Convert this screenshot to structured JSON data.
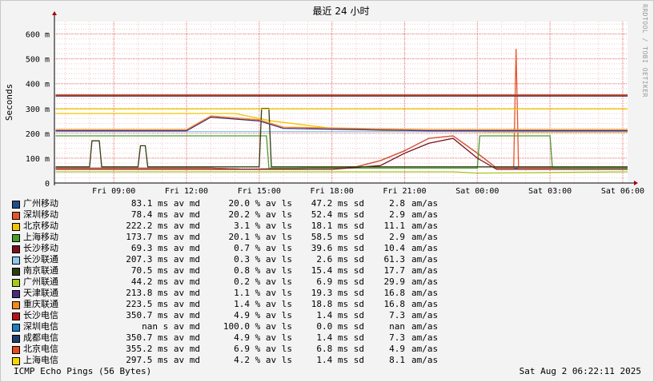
{
  "chart_data": {
    "type": "line",
    "title": "最近 24 小时",
    "ylabel": "Seconds",
    "ylim": [
      0,
      0.65
    ],
    "yticks": [
      {
        "v": 0,
        "label": "0"
      },
      {
        "v": 0.1,
        "label": "100 m"
      },
      {
        "v": 0.2,
        "label": "200 m"
      },
      {
        "v": 0.3,
        "label": "300 m"
      },
      {
        "v": 0.4,
        "label": "400 m"
      },
      {
        "v": 0.5,
        "label": "500 m"
      },
      {
        "v": 0.6,
        "label": "600 m"
      }
    ],
    "xlim": [
      6.55,
      30.2
    ],
    "xticks": [
      {
        "v": 9,
        "label": "Fri 09:00"
      },
      {
        "v": 12,
        "label": "Fri 12:00"
      },
      {
        "v": 15,
        "label": "Fri 15:00"
      },
      {
        "v": 18,
        "label": "Fri 18:00"
      },
      {
        "v": 21,
        "label": "Fri 21:00"
      },
      {
        "v": 24,
        "label": "Sat 00:00"
      },
      {
        "v": 27,
        "label": "Sat 03:00"
      },
      {
        "v": 30,
        "label": "Sat 06:00"
      }
    ],
    "grid": true,
    "legend_position": "bottom",
    "series": [
      {
        "name": "广州移动",
        "color": "#1f4e8c",
        "x": [
          6.6,
          13.0,
          14.5,
          17.0,
          19.0,
          20.0,
          21.0,
          22.0,
          23.0,
          24.0,
          24.8,
          30.2
        ],
        "y": [
          0.06,
          0.06,
          0.055,
          0.06,
          0.065,
          0.09,
          0.13,
          0.18,
          0.19,
          0.12,
          0.06,
          0.06
        ]
      },
      {
        "name": "深圳移动",
        "color": "#e8542a",
        "x": [
          6.6,
          13.0,
          14.5,
          17.0,
          19.0,
          20.0,
          21.0,
          22.0,
          23.0,
          24.0,
          24.8,
          25.5,
          25.6,
          25.7,
          30.2
        ],
        "y": [
          0.06,
          0.06,
          0.055,
          0.06,
          0.065,
          0.09,
          0.13,
          0.18,
          0.19,
          0.12,
          0.06,
          0.06,
          0.54,
          0.06,
          0.06
        ]
      },
      {
        "name": "北京移动",
        "color": "#f2c200",
        "x": [
          6.6,
          14.0,
          15.5,
          18.0,
          20.5,
          22.0,
          24.5,
          27.0,
          30.2
        ],
        "y": [
          0.28,
          0.28,
          0.25,
          0.22,
          0.21,
          0.21,
          0.205,
          0.205,
          0.205
        ]
      },
      {
        "name": "上海移动",
        "color": "#4a9c2e",
        "x": [
          6.6,
          15.3,
          15.4,
          24.0,
          24.1,
          27.0,
          27.1,
          30.2
        ],
        "y": [
          0.19,
          0.19,
          0.06,
          0.06,
          0.19,
          0.19,
          0.06,
          0.06
        ]
      },
      {
        "name": "长沙移动",
        "color": "#7a1020",
        "x": [
          6.6,
          18.0,
          20.0,
          21.0,
          22.0,
          23.0,
          24.0,
          24.8,
          30.2
        ],
        "y": [
          0.055,
          0.055,
          0.07,
          0.12,
          0.16,
          0.18,
          0.1,
          0.055,
          0.055
        ]
      },
      {
        "name": "长沙联通",
        "color": "#8ec9f0",
        "x": [
          6.6,
          30.2
        ],
        "y": [
          0.207,
          0.207
        ]
      },
      {
        "name": "南京联通",
        "color": "#2c3e12",
        "x": [
          6.6,
          8.0,
          8.1,
          8.4,
          8.5,
          10.0,
          10.1,
          10.3,
          10.4,
          15.0,
          15.1,
          15.4,
          15.5,
          30.2
        ],
        "y": [
          0.065,
          0.065,
          0.17,
          0.17,
          0.065,
          0.065,
          0.15,
          0.15,
          0.065,
          0.065,
          0.3,
          0.3,
          0.065,
          0.065
        ]
      },
      {
        "name": "广州联通",
        "color": "#a8c81a",
        "x": [
          6.6,
          23.0,
          24.0,
          30.2
        ],
        "y": [
          0.045,
          0.045,
          0.04,
          0.045
        ]
      },
      {
        "name": "天津联通",
        "color": "#4a2a7a",
        "x": [
          6.6,
          12.0,
          13.0,
          15.0,
          16.0,
          19.0,
          22.0,
          24.0,
          30.2
        ],
        "y": [
          0.21,
          0.21,
          0.265,
          0.25,
          0.22,
          0.215,
          0.21,
          0.21,
          0.21
        ]
      },
      {
        "name": "重庆联通",
        "color": "#f08a1c",
        "x": [
          6.6,
          12.0,
          13.0,
          15.0,
          16.0,
          19.0,
          22.0,
          24.0,
          30.2
        ],
        "y": [
          0.215,
          0.215,
          0.27,
          0.255,
          0.225,
          0.22,
          0.215,
          0.215,
          0.215
        ]
      },
      {
        "name": "长沙电信",
        "color": "#b31515",
        "x": [
          6.6,
          30.2
        ],
        "y": [
          0.35,
          0.35
        ]
      },
      {
        "name": "深圳电信",
        "color": "#1a7fc4",
        "x": [],
        "y": []
      },
      {
        "name": "成都电信",
        "color": "#1f3d6e",
        "x": [
          6.6,
          30.2
        ],
        "y": [
          0.351,
          0.351
        ]
      },
      {
        "name": "北京电信",
        "color": "#e84a1a",
        "x": [
          6.6,
          30.2
        ],
        "y": [
          0.355,
          0.355
        ]
      },
      {
        "name": "上海电信",
        "color": "#f5d800",
        "x": [
          6.6,
          30.2
        ],
        "y": [
          0.2975,
          0.2975
        ]
      }
    ],
    "stats": [
      {
        "avg": "83.1 ms av md",
        "loss": "20.0 % av ls",
        "sd": "47.2 ms sd",
        "amas": "2.8",
        "unit": "am/as"
      },
      {
        "avg": "78.4 ms av md",
        "loss": "20.2 % av ls",
        "sd": "52.4 ms sd",
        "amas": "2.9",
        "unit": "am/as"
      },
      {
        "avg": "222.2 ms av md",
        "loss": "3.1 % av ls",
        "sd": "18.1 ms sd",
        "amas": "11.1",
        "unit": "am/as"
      },
      {
        "avg": "173.7 ms av md",
        "loss": "20.1 % av ls",
        "sd": "58.5 ms sd",
        "amas": "2.9",
        "unit": "am/as"
      },
      {
        "avg": "69.3 ms av md",
        "loss": "0.7 % av ls",
        "sd": "39.6 ms sd",
        "amas": "10.4",
        "unit": "am/as"
      },
      {
        "avg": "207.3 ms av md",
        "loss": "0.3 % av ls",
        "sd": "2.6 ms sd",
        "amas": "61.3",
        "unit": "am/as"
      },
      {
        "avg": "70.5 ms av md",
        "loss": "0.8 % av ls",
        "sd": "15.4 ms sd",
        "amas": "17.7",
        "unit": "am/as"
      },
      {
        "avg": "44.2 ms av md",
        "loss": "0.2 % av ls",
        "sd": "6.9 ms sd",
        "amas": "29.9",
        "unit": "am/as"
      },
      {
        "avg": "213.8 ms av md",
        "loss": "1.1 % av ls",
        "sd": "19.3 ms sd",
        "amas": "16.8",
        "unit": "am/as"
      },
      {
        "avg": "223.5 ms av md",
        "loss": "1.4 % av ls",
        "sd": "18.8 ms sd",
        "amas": "16.8",
        "unit": "am/as"
      },
      {
        "avg": "350.7 ms av md",
        "loss": "4.9 % av ls",
        "sd": "1.4 ms sd",
        "amas": "7.3",
        "unit": "am/as"
      },
      {
        "avg": "nan s av md",
        "loss": "100.0 % av ls",
        "sd": "0.0 ms sd",
        "amas": "nan",
        "unit": "am/as"
      },
      {
        "avg": "350.7 ms av md",
        "loss": "4.9 % av ls",
        "sd": "1.4 ms sd",
        "amas": "7.3",
        "unit": "am/as"
      },
      {
        "avg": "355.2 ms av md",
        "loss": "6.9 % av ls",
        "sd": "6.8 ms sd",
        "amas": "4.9",
        "unit": "am/as"
      },
      {
        "avg": "297.5 ms av md",
        "loss": "4.2 % av ls",
        "sd": "1.4 ms sd",
        "amas": "8.1",
        "unit": "am/as"
      }
    ]
  },
  "footer": {
    "left": "ICMP Echo Pings (56 Bytes)",
    "right": "Sat Aug  2 06:22:11 2025"
  },
  "credit": "RRDTOOL / TOBI OETIKER"
}
